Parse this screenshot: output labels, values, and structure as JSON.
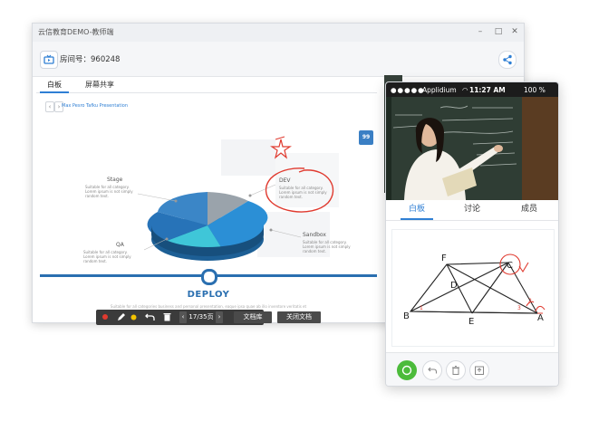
{
  "window": {
    "title": "云信教育DEMO-教师端",
    "minimize": "–",
    "maximize": "□",
    "close": "✕"
  },
  "room": {
    "label": "房间号：960248"
  },
  "tabs": [
    {
      "label": "白板"
    },
    {
      "label": "屏幕共享"
    }
  ],
  "slide": {
    "prev": "‹",
    "next": "›",
    "title": "Max Pesro Tafku Presentation",
    "badge": "99",
    "segments": [
      {
        "label": "Stage",
        "desc": "Suitable for all category. Lorem ipsum is not simply random text."
      },
      {
        "label": "DEV",
        "desc": "Suitable for all category. Lorem ipsum is not simply random text."
      },
      {
        "label": "QA",
        "desc": "Suitable for all category. Lorem ipsum is not simply random text."
      },
      {
        "label": "Sandbox",
        "desc": "Suitable for all category. Lorem ipsum is not simply random text."
      }
    ],
    "deploy": "DEPLOY",
    "deploy_desc": "Suitable for all categories business and personal presentation, eaque ipsa quae ab illo inventore veritatis et"
  },
  "toolbar": {
    "page": "17/35页",
    "prev": "‹",
    "next": "›",
    "doc_library": "文档库",
    "close_doc": "关闭文档",
    "colors": {
      "red": "#e03a2f",
      "yellow": "#f2c200"
    }
  },
  "phone": {
    "carrier": "Applidium",
    "time": "11:27 AM",
    "battery": "100 %",
    "tabs": [
      {
        "label": "白板"
      },
      {
        "label": "讨论"
      },
      {
        "label": "成员"
      }
    ],
    "geometry_labels": [
      "F",
      "C",
      "D",
      "B",
      "E",
      "A",
      "1",
      "2",
      "3"
    ]
  },
  "colors": {
    "accent": "#2f7fd4",
    "deploy": "#2a6fb0",
    "annotation": "#e03a2f",
    "green": "#4cbb3b"
  }
}
